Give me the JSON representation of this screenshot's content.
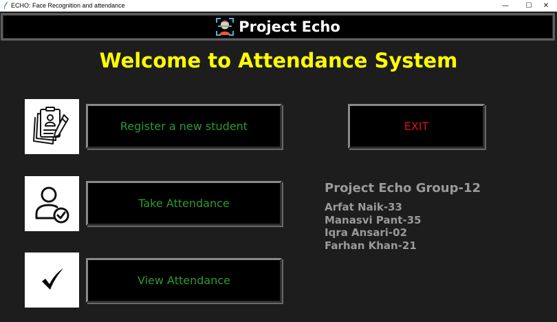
{
  "window": {
    "title": "ECHO: Face Recognition and attendance",
    "controls": {
      "minimize": "—",
      "maximize": "☐",
      "close": "✕"
    }
  },
  "header": {
    "title": "Project Echo",
    "logo_icon": "face-scan-icon"
  },
  "welcome": "Welcome to Attendance System",
  "actions": [
    {
      "label": "Register a new student",
      "icon": "register-document-pen-icon",
      "color": "#2e9a2e"
    },
    {
      "label": "Take Attendance",
      "icon": "user-check-icon",
      "color": "#2e9a2e"
    },
    {
      "label": "View Attendance",
      "icon": "checkmark-icon",
      "color": "#2e9a2e"
    }
  ],
  "exit": {
    "label": "EXIT",
    "color": "#e01010"
  },
  "group": {
    "title": "Project Echo Group-12",
    "members": [
      "Arfat Naik-33",
      "Manasvi Pant-35",
      "Iqra Ansari-02",
      "Farhan Khan-21"
    ]
  },
  "colors": {
    "background": "#1d1d1d",
    "heading": "#ffff00",
    "button_text": "#2e9a2e",
    "exit_text": "#e01010",
    "info_text": "#9a9a9a"
  }
}
